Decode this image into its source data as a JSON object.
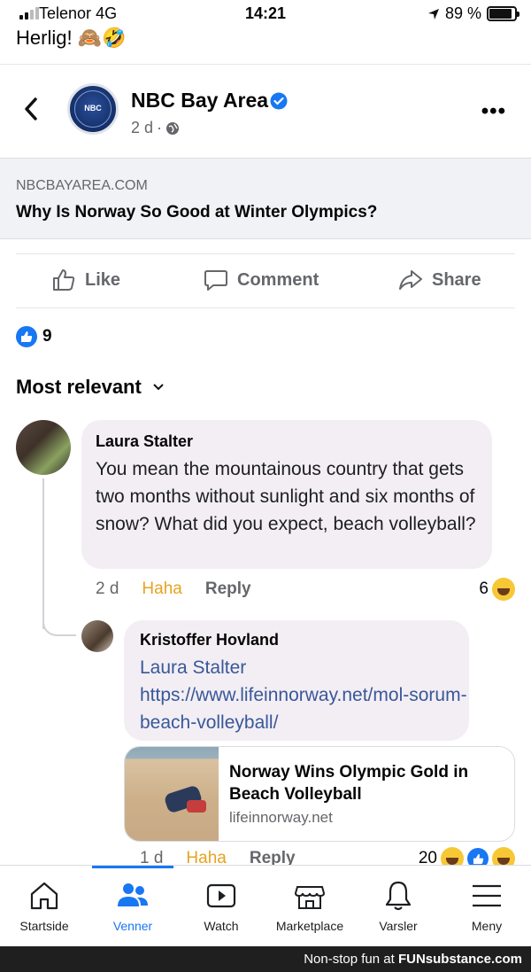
{
  "status_bar": {
    "carrier": "Telenor",
    "network": "4G",
    "time": "14:21",
    "battery": "89 %",
    "battery_level": 0.89
  },
  "previous_post_text": "Herlig! 🙈🤣",
  "post": {
    "page_name": "NBC Bay Area",
    "logo_text": "NBC",
    "age": "2 d",
    "separator": "·",
    "link": {
      "domain": "NBCBAYAREA.COM",
      "title": "Why Is Norway So Good at Winter Olympics?"
    },
    "actions": {
      "like": "Like",
      "comment": "Comment",
      "share": "Share"
    },
    "reaction_count": "9"
  },
  "sort_label": "Most relevant",
  "comments": [
    {
      "author": "Laura Stalter",
      "text": "You mean the mountainous country that gets two months without sunlight and six months of snow?  What did you expect, beach volleyball?",
      "age": "2 d",
      "haha": "Haha",
      "reply": "Reply",
      "reaction_count": "6"
    },
    {
      "author": "Kristoffer Hovland",
      "text": "Laura Stalter https://www.lifeinnorway.net/mol-sorum-beach-volleyball/",
      "age": "1 d",
      "haha": "Haha",
      "reply": "Reply",
      "reaction_count": "20",
      "preview": {
        "title": "Norway Wins Olympic Gold in Beach Volleyball",
        "domain": "lifeinnorway.net"
      }
    }
  ],
  "tabs": [
    {
      "label": "Startside",
      "icon": "home-icon"
    },
    {
      "label": "Venner",
      "icon": "friends-icon",
      "active": true
    },
    {
      "label": "Watch",
      "icon": "watch-icon"
    },
    {
      "label": "Marketplace",
      "icon": "marketplace-icon"
    },
    {
      "label": "Varsler",
      "icon": "bell-icon"
    },
    {
      "label": "Meny",
      "icon": "menu-icon"
    }
  ],
  "footer": {
    "prefix": "Non-stop fun at ",
    "brand": "FUNsubstance.com"
  },
  "colors": {
    "accent": "#1877f2",
    "haha": "#e6a320",
    "bubble": "#f3eef4"
  }
}
